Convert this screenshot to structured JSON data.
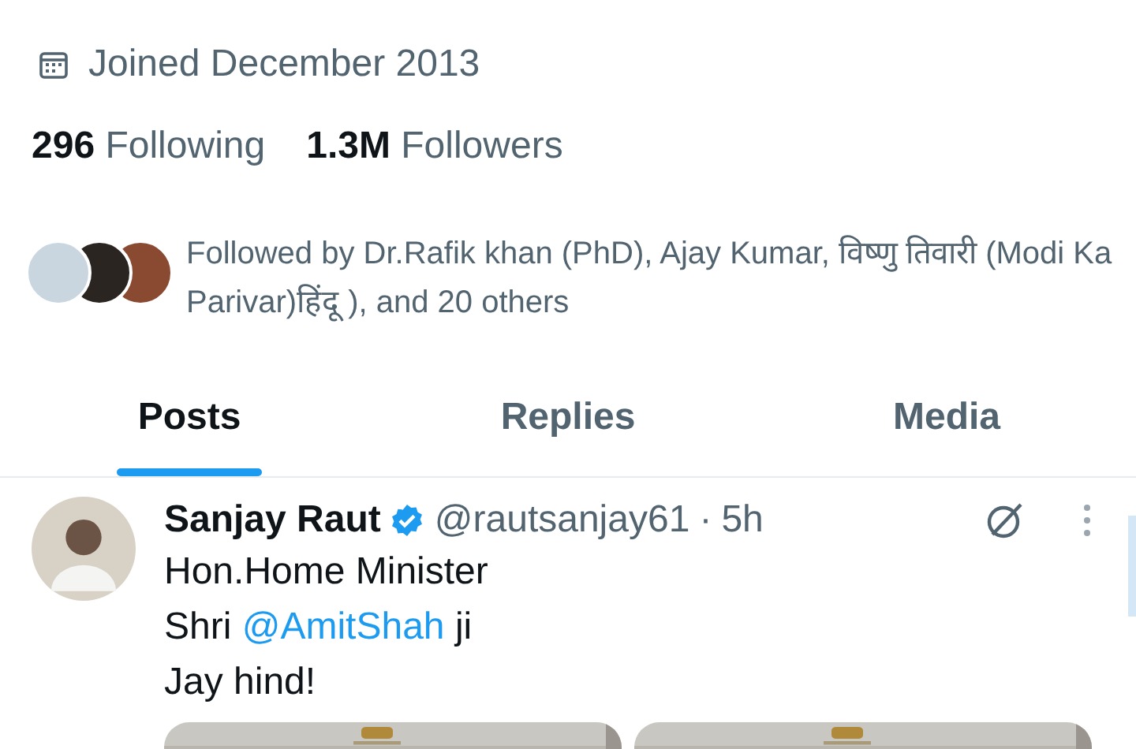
{
  "profile_meta": {
    "joined": "Joined December 2013"
  },
  "stats": [
    {
      "count": "296",
      "label": "Following"
    },
    {
      "count": "1.3M",
      "label": "Followers"
    }
  ],
  "followed_by": {
    "text": "Followed by Dr.Rafik khan (PhD), Ajay Kumar, विष्णु तिवारी (Modi Ka Parivar)हिंदू ), and 20 others",
    "avatars": [
      {
        "color": "#c9d6e0"
      },
      {
        "color": "#2b2522"
      },
      {
        "color": "#8a4a32"
      }
    ]
  },
  "tabs": [
    {
      "label": "Posts",
      "selected": true
    },
    {
      "label": "Replies",
      "selected": false
    },
    {
      "label": "Media",
      "selected": false
    }
  ],
  "post": {
    "name": "Sanjay Raut",
    "verified": true,
    "handle": "@rautsanjay61",
    "separator": "·",
    "time": "5h",
    "lines": [
      [
        {
          "kind": "text",
          "text": "Hon.Home Minister"
        }
      ],
      [
        {
          "kind": "text",
          "text": "Shri "
        },
        {
          "kind": "mention",
          "text": "@AmitShah"
        },
        {
          "kind": "text",
          "text": " ji"
        }
      ],
      [
        {
          "kind": "text",
          "text": "Jay hind!"
        }
      ]
    ],
    "media": [
      {
        "kind": "picture"
      },
      {
        "kind": "picture"
      }
    ]
  }
}
